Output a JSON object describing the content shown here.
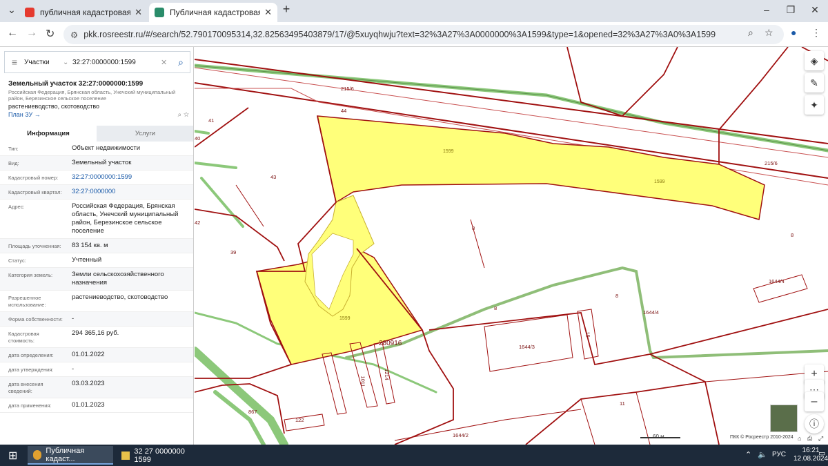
{
  "browser": {
    "tabs": [
      {
        "label": "публичная кадастровая карта",
        "icon": "yandex-icon"
      },
      {
        "label": "Публичная кадастровая карта",
        "icon": "rosreestr-icon"
      }
    ],
    "new_tab": "+",
    "url": "pkk.rosreestr.ru/#/search/52.790170095314,32.82563495403879/17/@5xuyqhwju?text=32%3A27%3A0000000%3A1599&type=1&opened=32%3A27%3A0%3A1599"
  },
  "search": {
    "type": "Участки",
    "query": "32:27:0000000:1599"
  },
  "object": {
    "title": "Земельный участок 32:27:0000000:1599",
    "address_short": "Российская Федерация, Брянская область, Унечский муниципальный район, Березинское сельское поселение",
    "use": "растениеводство, скотоводство",
    "plan_link": "План ЗУ →"
  },
  "tabs": {
    "info": "Информация",
    "services": "Услуги"
  },
  "props": [
    {
      "k": "Тип:",
      "v": "Объект недвижимости"
    },
    {
      "k": "Вид:",
      "v": "Земельный участок"
    },
    {
      "k": "Кадастровый номер:",
      "v": "32:27:0000000:1599",
      "link": true
    },
    {
      "k": "Кадастровый квартал:",
      "v": "32:27:0000000",
      "link": true
    },
    {
      "k": "Адрес:",
      "v": "Российская Федерация, Брянская область, Унечский муниципальный район, Березинское сельское поселение"
    },
    {
      "k": "Площадь уточненная:",
      "v": "83 154 кв. м"
    },
    {
      "k": "Статус:",
      "v": "Учтенный"
    },
    {
      "k": "Категория земель:",
      "v": "Земли сельскохозяйственного назначения"
    },
    {
      "k": "Разрешенное использование:",
      "v": "растениеводство, скотоводство"
    },
    {
      "k": "Форма собственности:",
      "v": "-"
    },
    {
      "k": "Кадастровая стоимость:",
      "v": "294 365,16 руб."
    },
    {
      "k": "дата определения:",
      "v": "01.01.2022"
    },
    {
      "k": "дата утверждения:",
      "v": "-"
    },
    {
      "k": "дата внесения сведений:",
      "v": "03.03.2023"
    },
    {
      "k": "дата применения:",
      "v": "01.01.2023"
    }
  ],
  "map": {
    "labels": {
      "l215a": "215/6",
      "l44": "44",
      "l41": "41",
      "l40": "40",
      "l43": "43",
      "l42": "42",
      "l39": "39",
      "l1599a": "1599",
      "l1599b": "1599",
      "l1599c": "1599",
      "l215b": "215/6",
      "l8a": "8",
      "l8b": "8",
      "l8c": "8",
      "l8d": "8",
      "l1644_4a": "1644/4",
      "l1644_4b": "1644/4",
      "l1644_3": "1644/3",
      "l1644_2": "1644/2",
      "l280916": "280916",
      "l1011": "1011",
      "l1214": "1214",
      "l15": "15",
      "l867": "867",
      "l122": "122",
      "l11": "11"
    },
    "scale": "60 м",
    "copyright": "ПКК © Росреестр 2010-2024",
    "colors": {
      "parcel": "#ffff7a",
      "border": "#a01010",
      "road": "#8cc87a"
    }
  },
  "taskbar": {
    "app1": "Публичная кадаст...",
    "app2": "32 27 0000000 1599",
    "lang": "РУС",
    "time": "16:21",
    "date": "12.08.2024"
  }
}
